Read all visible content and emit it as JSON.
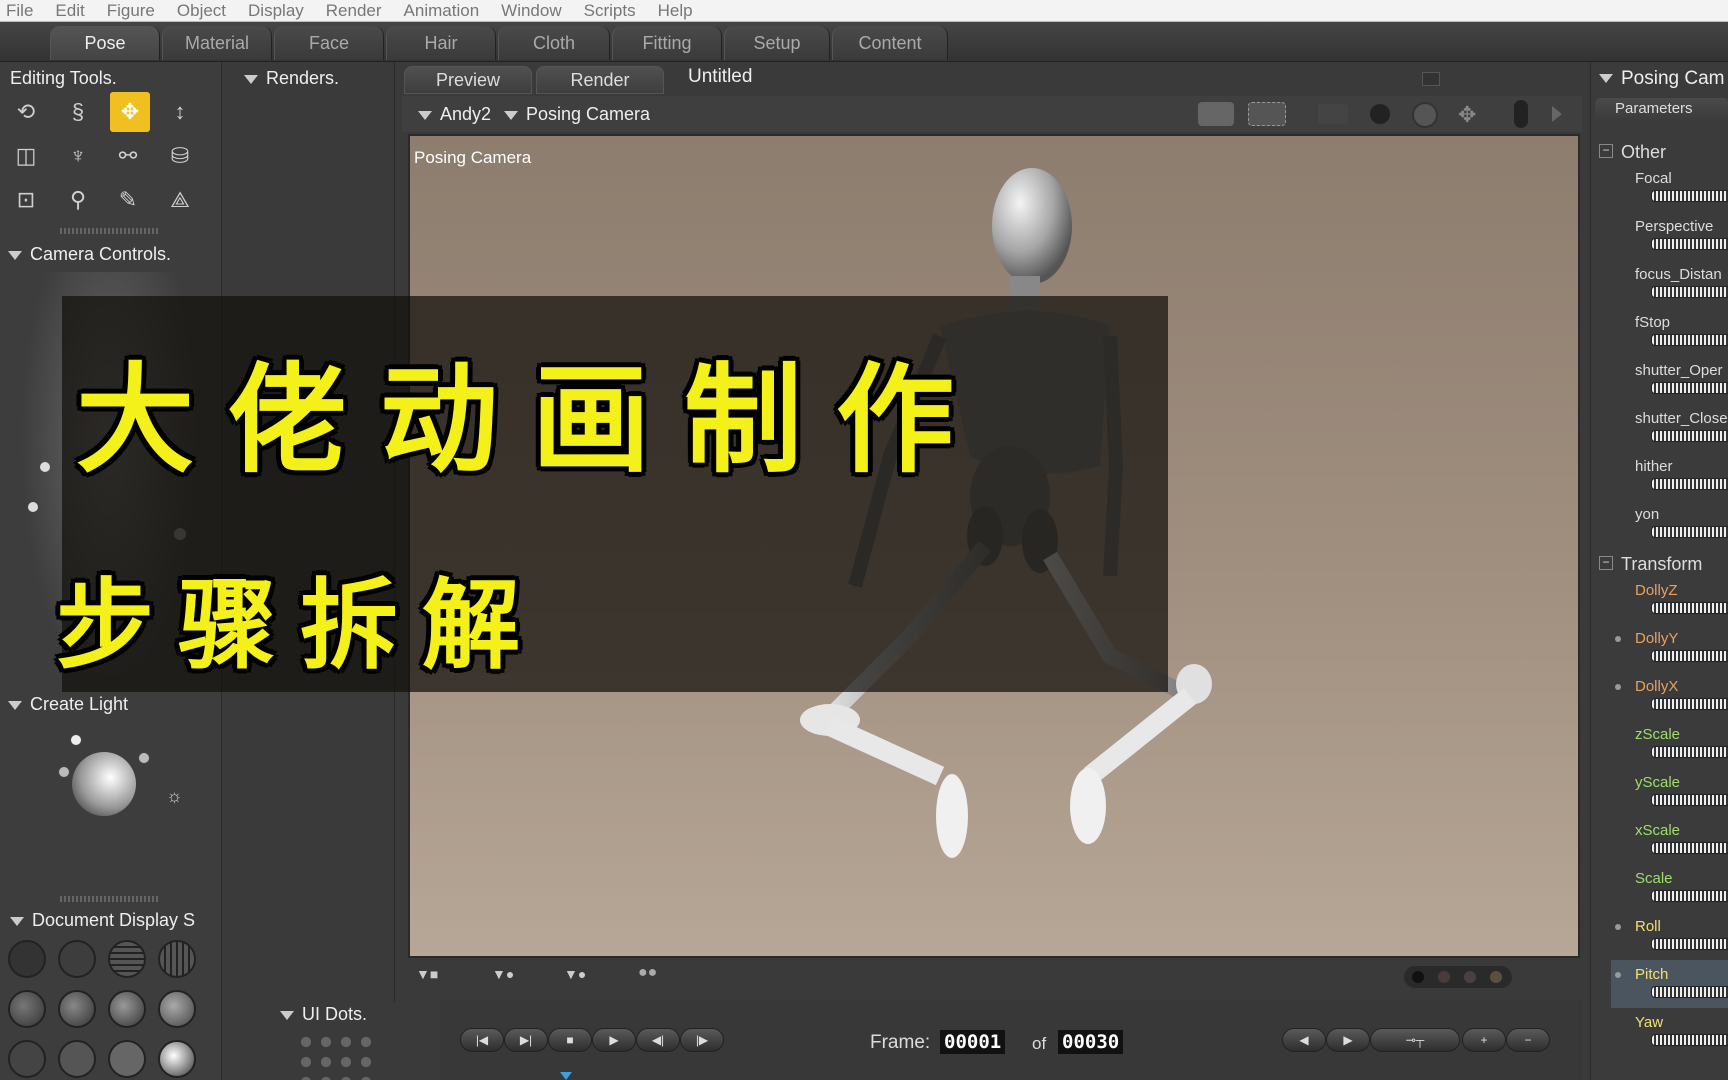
{
  "menu": [
    "File",
    "Edit",
    "Figure",
    "Object",
    "Display",
    "Render",
    "Animation",
    "Window",
    "Scripts",
    "Help"
  ],
  "room_tabs": [
    "Pose",
    "Material",
    "Face",
    "Hair",
    "Cloth",
    "Fitting",
    "Setup",
    "Content"
  ],
  "left": {
    "editing_tools_title": "Editing Tools.",
    "camera_controls_title": "Camera Controls.",
    "create_light_title": "Create Light",
    "document_display_title": "Document Display S"
  },
  "renders_title": "Renders.",
  "ui_dots_title": "UI Dots.",
  "doc_tabs": {
    "preview": "Preview",
    "render": "Render",
    "doc_title": "Untitled"
  },
  "view_bar": {
    "figure": "Andy2",
    "camera": "Posing Camera"
  },
  "viewport": {
    "camera_label": "Posing Camera"
  },
  "timeline": {
    "frame_label": "Frame:",
    "current_frame": "00001",
    "of_label": "of",
    "total_frames": "00030"
  },
  "right_panel": {
    "title": "Posing Cam",
    "tab": "Parameters",
    "group_other": "Other",
    "other_params": [
      "Focal",
      "Perspective",
      "focus_Distan",
      "fStop",
      "shutter_Oper",
      "shutter_Close",
      "hither",
      "yon"
    ],
    "group_transform": "Transform",
    "transform_params": [
      {
        "name": "DollyZ",
        "color": "#e8a060"
      },
      {
        "name": "DollyY",
        "color": "#e8a060"
      },
      {
        "name": "DollyX",
        "color": "#e8a060"
      },
      {
        "name": "zScale",
        "color": "#9be06a"
      },
      {
        "name": "yScale",
        "color": "#9be06a"
      },
      {
        "name": "xScale",
        "color": "#9be06a"
      },
      {
        "name": "Scale",
        "color": "#9be06a"
      },
      {
        "name": "Roll",
        "color": "#f0e070"
      },
      {
        "name": "Pitch",
        "color": "#f0e070"
      },
      {
        "name": "Yaw",
        "color": "#f0e070"
      }
    ]
  },
  "overlay": {
    "line1": "大佬动画制作",
    "line2": "步骤拆解"
  },
  "colors": {
    "accent_tool": "#f0c020",
    "overlay_text": "#f4f01a"
  }
}
